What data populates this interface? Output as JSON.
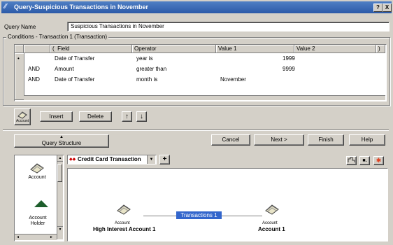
{
  "window": {
    "title": "Query-Suspicious Transactions in November",
    "help_btn": "?",
    "close_btn": "X"
  },
  "query_name": {
    "label": "Query Name",
    "value": "Suspicious Transactions in November"
  },
  "conditions": {
    "legend": "Conditions - Transaction 1 (Transaction)",
    "columns": [
      "(",
      "Field",
      "Operator",
      "Value 1",
      "Value 2",
      ")"
    ],
    "rows": [
      {
        "marker": "•",
        "connector": "",
        "field": "Date of Transfer",
        "operator": "year is",
        "value1": "1999",
        "value2": ""
      },
      {
        "marker": "",
        "connector": "AND",
        "field": "Amount",
        "operator": "greater than",
        "value1": "9999",
        "value2": ""
      },
      {
        "marker": "",
        "connector": "AND",
        "field": "Date of Transfer",
        "operator": "month is",
        "value1": "November",
        "value2": ""
      }
    ]
  },
  "toolbar": {
    "account_icon_label": "Account",
    "insert": "Insert",
    "delete": "Delete",
    "up": "↑",
    "down": "↓"
  },
  "query_structure": {
    "arrow": "▲",
    "label": "Query Structure"
  },
  "nav": {
    "cancel": "Cancel",
    "next": "Next >",
    "finish": "Finish",
    "help": "Help"
  },
  "palette": {
    "items": [
      {
        "label": "Account"
      },
      {
        "label": "Account Holder"
      }
    ]
  },
  "structure": {
    "selector_value": "Credit Card Transaction",
    "add_btn": "+",
    "node_left": {
      "type": "Account",
      "name": "High Interest Account 1"
    },
    "link_label": "Transactions 1",
    "node_right": {
      "type": "Account",
      "name": "Account 1"
    }
  },
  "colors": {
    "title_bar": "#2c5aa8",
    "link_highlight": "#3366cc",
    "selection": "#0a246a"
  }
}
